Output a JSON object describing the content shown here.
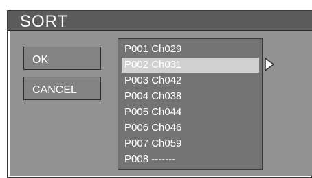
{
  "window": {
    "title": "SORT"
  },
  "buttons": {
    "ok_label": "OK",
    "cancel_label": "CANCEL"
  },
  "list": {
    "items": [
      {
        "label": "P001 Ch029",
        "selected": false
      },
      {
        "label": "P002 Ch031",
        "selected": true
      },
      {
        "label": "P003 Ch042",
        "selected": false
      },
      {
        "label": "P004 Ch038",
        "selected": false
      },
      {
        "label": "P005 Ch044",
        "selected": false
      },
      {
        "label": "P006 Ch046",
        "selected": false
      },
      {
        "label": "P007 Ch059",
        "selected": false
      },
      {
        "label": "P008 -------",
        "selected": false
      }
    ]
  },
  "icons": {
    "selection_arrow": "triangle-right-outline-icon"
  },
  "colors": {
    "title_bar": "#5c5c5c",
    "panel": "#929292",
    "list_bg": "#747474",
    "selection": "#d0d0d0",
    "text": "#ffffff"
  }
}
